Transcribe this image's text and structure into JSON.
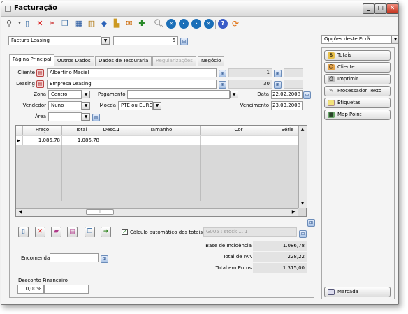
{
  "window": {
    "title": "Facturação"
  },
  "header": {
    "doc_type": "Factura Leasing",
    "doc_number": "6",
    "screen_options": "Opções deste Ecrã"
  },
  "tabs": [
    {
      "label": "Página Principal"
    },
    {
      "label": "Outros Dados"
    },
    {
      "label": "Dados de Tesouraria"
    },
    {
      "label": "Regularizações"
    },
    {
      "label": "Negócio"
    }
  ],
  "form": {
    "cliente_label": "Cliente",
    "cliente_value": "Albertino Maciel",
    "cliente_code": "1",
    "leasing_label": "Leasing",
    "leasing_value": "Empresa Leasing",
    "leasing_code": "30",
    "zona_label": "Zona",
    "zona_value": "Centro",
    "pagamento_label": "Pagamento",
    "pagamento_value": "",
    "data_label": "Data",
    "data_value": "22.02.2008",
    "vendedor_label": "Vendedor",
    "vendedor_value": "Nuno",
    "moeda_label": "Moeda",
    "moeda_value": "PTE ou EURO",
    "vencimento_label": "Vencimento",
    "vencimento_value": "23.03.2008",
    "area_label": "Área",
    "area_value": ""
  },
  "grid": {
    "columns": [
      "Preço",
      "Total",
      "Desc.1",
      "Tamanho",
      "Cor",
      "Série"
    ],
    "rows": [
      {
        "preco": "1.086,78",
        "total": "1.086,78",
        "desc1": "",
        "tamanho": "",
        "cor": "",
        "serie": ""
      }
    ],
    "scroll_marker": "III"
  },
  "actions": {
    "auto_calc_label": "Cálculo automático dos totais",
    "auto_calc_checked": true,
    "stock_info": "G005 : stock ... 1"
  },
  "totals": {
    "base_label": "Base de Incidência",
    "base_value": "1.086,78",
    "iva_label": "Total de IVA",
    "iva_value": "228,22",
    "euros_label": "Total em Euros",
    "euros_value": "1.315,00"
  },
  "encomenda": {
    "label": "Encomenda",
    "value": ""
  },
  "desconto": {
    "label": "Desconto Financeiro",
    "value": "0,00%"
  },
  "side_buttons": [
    {
      "label": "Totais",
      "icon": "coins-icon"
    },
    {
      "label": "Cliente",
      "icon": "user-icon"
    },
    {
      "label": "Imprimir",
      "icon": "printer-icon"
    },
    {
      "label": "Processador Texto",
      "icon": "pen-icon"
    },
    {
      "label": "Etiquetas",
      "icon": "label-icon"
    },
    {
      "label": "Map Point",
      "icon": "map-icon"
    }
  ],
  "marcada_button": "Marcada",
  "colors": {
    "window_bg": "#f4f4f4",
    "title_gradient_top": "#fdfdfd",
    "accent": "#1b6fb8"
  }
}
